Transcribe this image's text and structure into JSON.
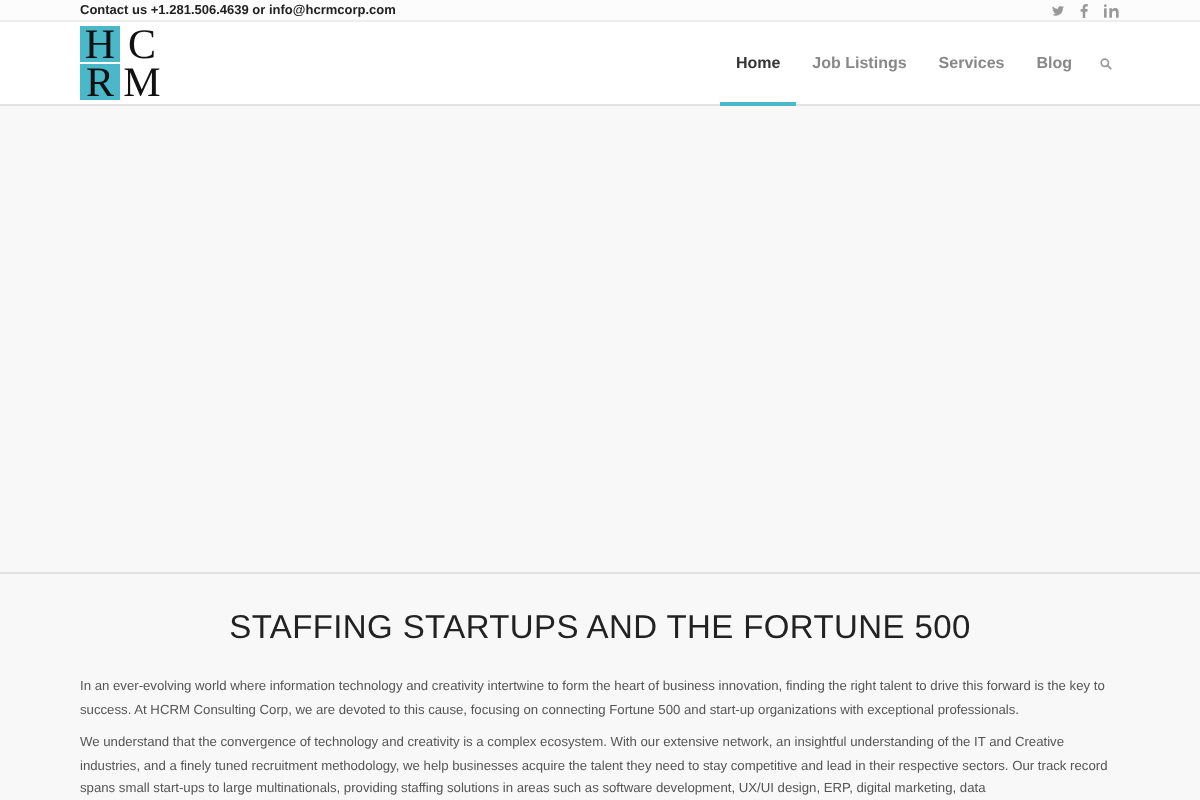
{
  "top_bar": {
    "contact": "Contact us +1.281.506.4639 or info@hcrmcorp.com"
  },
  "logo": {
    "letters": [
      {
        "text": "H",
        "highlighted": true
      },
      {
        "text": "C",
        "highlighted": false
      },
      {
        "text": "R",
        "highlighted": true
      },
      {
        "text": "M",
        "highlighted": false
      }
    ]
  },
  "nav": [
    {
      "label": "Home",
      "selected": true
    },
    {
      "label": "Job Listings",
      "selected": false
    },
    {
      "label": "Services",
      "selected": false
    },
    {
      "label": "Blog",
      "selected": false
    }
  ],
  "section": {
    "title": "STAFFING STARTUPS AND THE FORTUNE 500",
    "paragraphs": [
      "In an ever-evolving world where information technology and creativity intertwine to form the heart of business innovation, finding the right talent to drive this forward is the key to success. At HCRM Consulting Corp, we are devoted to this cause, focusing on connecting Fortune 500 and start-up organizations with exceptional professionals.",
      "We understand that the convergence of technology and creativity is a complex ecosystem. With our extensive network, an insightful understanding of the IT and Creative industries, and a finely tuned recruitment methodology, we help businesses acquire the talent they need to stay competitive and lead in their respective sectors. Our track record spans small start-ups to large multinationals, providing staffing solutions in areas such as software development, UX/UI design, ERP,  digital marketing, data"
    ]
  }
}
